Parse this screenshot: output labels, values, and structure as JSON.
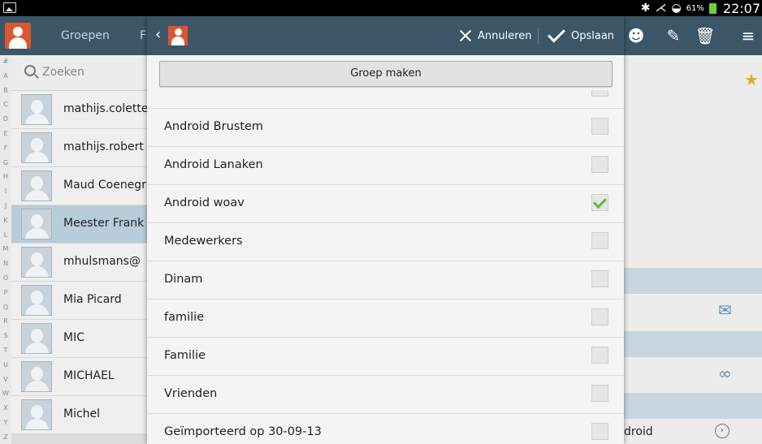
{
  "status_bar": {
    "battery": "61%",
    "time": "22:07"
  },
  "action_bar": {
    "tab_groups": "Groepen",
    "tab_cut": "F"
  },
  "contacts": {
    "search_placeholder": "Zoeken",
    "alphabet": [
      "#",
      "A",
      "B",
      "C",
      "D",
      "E",
      "F",
      "G",
      "H",
      "I",
      "J",
      "K",
      "L",
      "M",
      "N",
      "O",
      "P",
      "Q",
      "R",
      "S",
      "T",
      "U",
      "V",
      "W",
      "X",
      "Y",
      "Z"
    ],
    "items": [
      {
        "name": "mathijs.colette"
      },
      {
        "name": "mathijs.robert"
      },
      {
        "name": "Maud Coenegr"
      },
      {
        "name": "Meester Frank"
      },
      {
        "name": "mhulsmans@"
      },
      {
        "name": "Mia Picard"
      },
      {
        "name": "MIC"
      },
      {
        "name": "MICHAEL"
      },
      {
        "name": "Michel"
      }
    ],
    "selected_index": 3
  },
  "detail": {
    "bottom_text": "droid"
  },
  "dialog": {
    "cancel_label": "Annuleren",
    "save_label": "Opslaan",
    "make_group_label": "Groep maken",
    "groups": [
      {
        "label": "",
        "checked": false
      },
      {
        "label": "Android Brustem",
        "checked": false
      },
      {
        "label": "Android Lanaken",
        "checked": false
      },
      {
        "label": "Android woav",
        "checked": true
      },
      {
        "label": "Medewerkers",
        "checked": false
      },
      {
        "label": "Dinam",
        "checked": false
      },
      {
        "label": "familie",
        "checked": false
      },
      {
        "label": "Familie",
        "checked": false
      },
      {
        "label": "Vrienden",
        "checked": false
      },
      {
        "label": "Geïmporteerd op 30-09-13",
        "checked": false
      }
    ]
  }
}
